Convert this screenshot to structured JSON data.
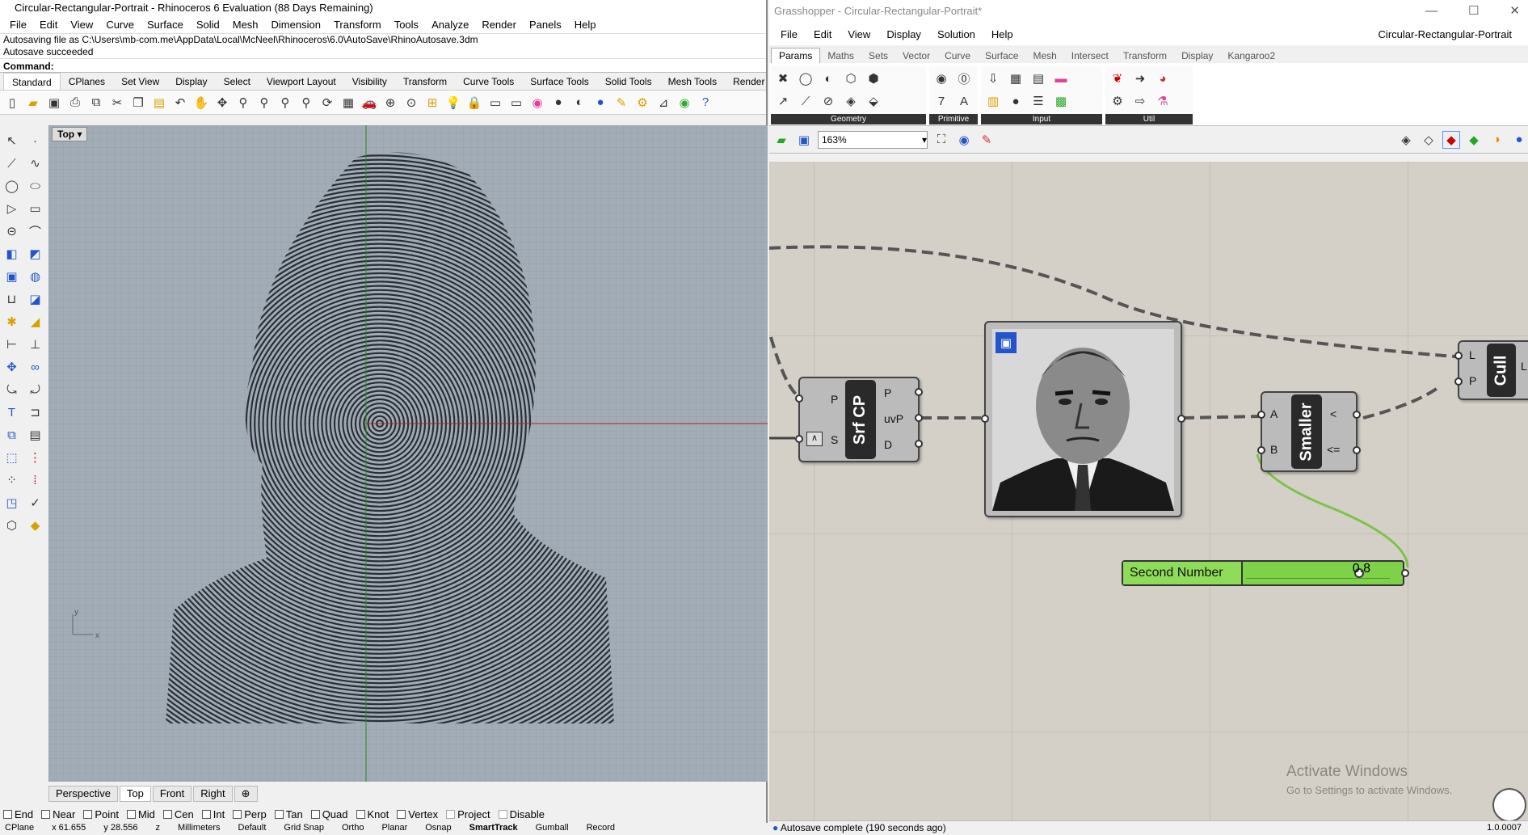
{
  "rhino": {
    "title": "Circular-Rectangular-Portrait - Rhinoceros 6 Evaluation (88 Days Remaining)",
    "menu": [
      "File",
      "Edit",
      "View",
      "Curve",
      "Surface",
      "Solid",
      "Mesh",
      "Dimension",
      "Transform",
      "Tools",
      "Analyze",
      "Render",
      "Panels",
      "Help"
    ],
    "history": [
      "Autosaving file as C:\\Users\\mb-com.me\\AppData\\Local\\McNeel\\Rhinoceros\\6.0\\AutoSave\\RhinoAutosave.3dm",
      "Autosave succeeded"
    ],
    "command_label": "Command:",
    "toolbar_tabs": [
      "Standard",
      "CPlanes",
      "Set View",
      "Display",
      "Select",
      "Viewport Layout",
      "Visibility",
      "Transform",
      "Curve Tools",
      "Surface Tools",
      "Solid Tools",
      "Mesh Tools",
      "Render To"
    ],
    "viewport_title": "Top",
    "viewport_tabs": [
      "Perspective",
      "Top",
      "Front",
      "Right"
    ],
    "osnaps": [
      "End",
      "Near",
      "Point",
      "Mid",
      "Cen",
      "Int",
      "Perp",
      "Tan",
      "Quad",
      "Knot",
      "Vertex",
      "Project",
      "Disable"
    ],
    "status": [
      "CPlane",
      "x 61.655",
      "y 28.556",
      "z",
      "Millimeters",
      "Default",
      "Grid Snap",
      "Ortho",
      "Planar",
      "Osnap",
      "SmartTrack",
      "Gumball",
      "Record"
    ],
    "axis_x": "x",
    "axis_y": "y"
  },
  "gh": {
    "title": "Grasshopper - Circular-Rectangular-Portrait*",
    "doc_name": "Circular-Rectangular-Portrait",
    "menu": [
      "File",
      "Edit",
      "View",
      "Display",
      "Solution",
      "Help"
    ],
    "tabs": [
      "Params",
      "Maths",
      "Sets",
      "Vector",
      "Curve",
      "Surface",
      "Mesh",
      "Intersect",
      "Transform",
      "Display",
      "Kangaroo2"
    ],
    "panels": [
      "Geometry",
      "Primitive",
      "Input",
      "Util"
    ],
    "zoom": "163%",
    "components": {
      "srfcp": {
        "name": "Srf CP",
        "inputs": [
          "P",
          "S"
        ],
        "outputs": [
          "P",
          "uvP",
          "D"
        ]
      },
      "smaller": {
        "name": "Smaller",
        "inputs": [
          "A",
          "B"
        ],
        "outputs": [
          "<",
          "<="
        ]
      },
      "cull": {
        "name": "Cull",
        "inputs": [
          "L",
          "P"
        ],
        "outputs": [
          "L"
        ]
      }
    },
    "slider": {
      "label": "Second Number",
      "value": "0.8",
      "fill": 0.8
    },
    "watermark": [
      "Activate Windows",
      "Go to Settings to activate Windows."
    ],
    "status": "Autosave complete (190 seconds ago)",
    "version": "1.0.0007"
  }
}
